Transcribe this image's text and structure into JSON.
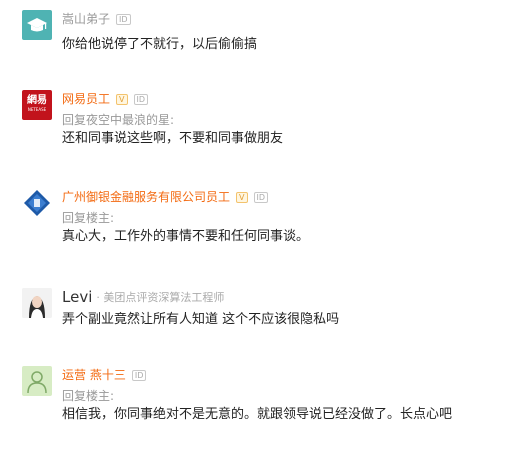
{
  "comments": [
    {
      "author": "嵩山弟子",
      "id_badge": "ID",
      "text": "你给他说停了不就行，以后偷偷搞"
    },
    {
      "author": "网易员工",
      "verified_badge": "V",
      "id_badge": "ID",
      "reply_to": "回复夜空中最浪的星:",
      "text": "还和同事说这些啊，不要和同事做朋友",
      "avatar_text": [
        "網",
        "易"
      ],
      "avatar_subtext": "NETEASE"
    },
    {
      "author": "广州御银金融服务有限公司员工",
      "verified_badge": "V",
      "id_badge": "ID",
      "reply_to": "回复楼主:",
      "text": "真心大，工作外的事情不要和任何同事谈。"
    },
    {
      "author": "Levi",
      "title": "· 美团点评资深算法工程师",
      "text": "弄个副业竟然让所有人知道 这个不应该很隐私吗"
    },
    {
      "author": "运营 燕十三",
      "id_badge": "ID",
      "reply_to": "回复楼主:",
      "text": "相信我，你同事绝对不是无意的。就跟领导说已经没做了。长点心吧"
    }
  ],
  "colors": {
    "orange_name": "#f36a11",
    "gray_name": "#999999",
    "teal_avatar": "#4fb3b3",
    "netease_red": "#c2131c"
  }
}
